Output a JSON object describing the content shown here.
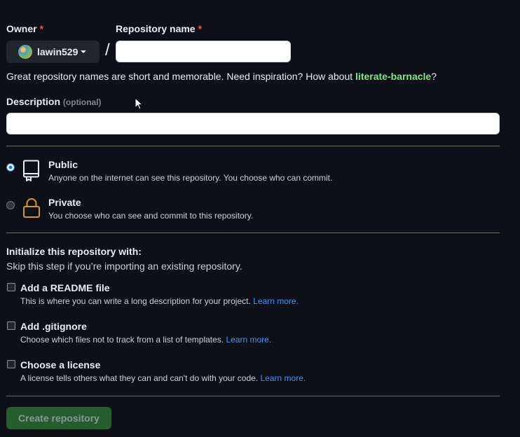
{
  "owner": {
    "label": "Owner",
    "required_mark": "*",
    "username": "lawin529"
  },
  "repo_name": {
    "label": "Repository name",
    "required_mark": "*",
    "value": "",
    "placeholder": ""
  },
  "separator": "/",
  "hint": {
    "prefix": "Great repository names are short and memorable. Need inspiration? How about ",
    "suggestion": "literate-barnacle",
    "suffix": "?"
  },
  "description": {
    "label": "Description",
    "optional": "(optional)",
    "value": "",
    "placeholder": ""
  },
  "visibility": {
    "selected": "public",
    "options": [
      {
        "title": "Public",
        "desc": "Anyone on the internet can see this repository. You choose who can commit.",
        "icon": "repo-icon"
      },
      {
        "title": "Private",
        "desc": "You choose who can see and commit to this repository.",
        "icon": "lock-icon"
      }
    ]
  },
  "init": {
    "title": "Initialize this repository with:",
    "subtitle": "Skip this step if you’re importing an existing repository.",
    "options": [
      {
        "title": "Add a README file",
        "desc": "This is where you can write a long description for your project.",
        "link": "Learn more.",
        "checked": false
      },
      {
        "title": "Add .gitignore",
        "desc": "Choose which files not to track from a list of templates.",
        "link": "Learn more.",
        "checked": false
      },
      {
        "title": "Choose a license",
        "desc": "A license tells others what they can and can't do with your code.",
        "link": "Learn more.",
        "checked": false
      }
    ]
  },
  "submit_label": "Create repository",
  "colors": {
    "background": "#0d1117",
    "accent_green": "#7ee787",
    "link_blue": "#4493f8",
    "required_red": "#f85149",
    "button_green": "#255e2e"
  }
}
